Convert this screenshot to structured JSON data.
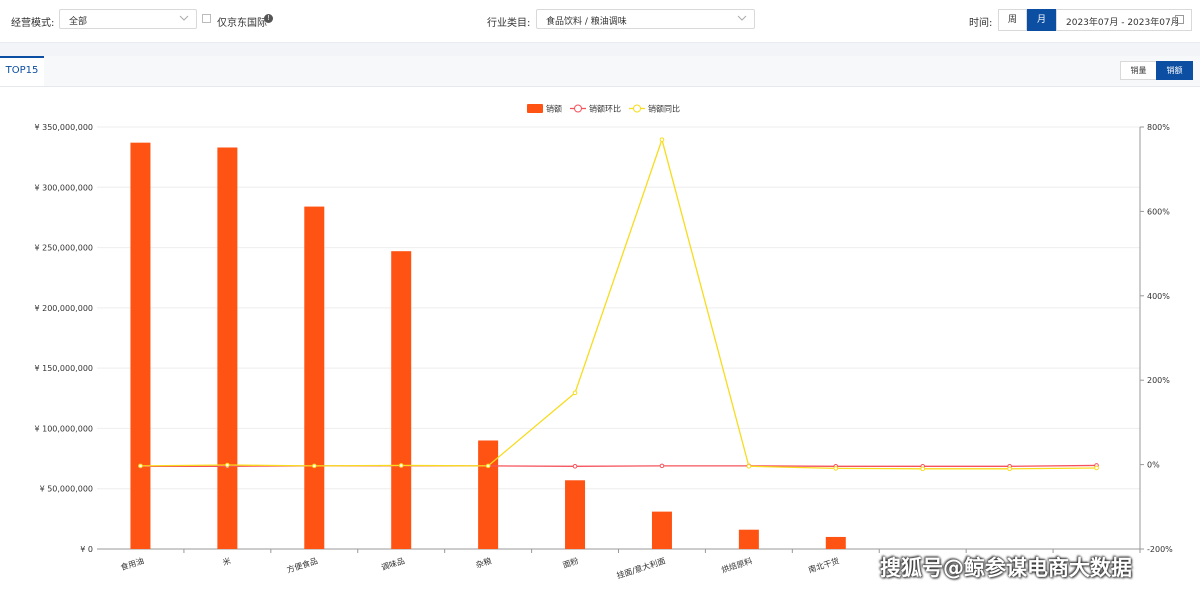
{
  "filters": {
    "mode_label": "经营模式:",
    "mode_value": "全部",
    "jd_intl_label": "仅京东国际",
    "category_label": "行业类目:",
    "category_value": "食品饮料 / 粮油调味",
    "time_label": "时间:",
    "period_week": "周",
    "period_month": "月",
    "date_range": "2023年07月 - 2023年07月"
  },
  "tabs": {
    "top15": "TOP15"
  },
  "metric_toggle": {
    "volume": "销量",
    "amount": "销额"
  },
  "watermark": "搜狐号@鲸参谋电商大数据",
  "colors": {
    "bar": "#ff5314",
    "mom_line": "#f5535c",
    "yoy_line": "#f7dc1d",
    "accent": "#0b4ea2"
  },
  "chart_data": {
    "type": "bar",
    "legend": [
      "销额",
      "销额环比",
      "销额同比"
    ],
    "legend_position": "top-center",
    "categories": [
      "食用油",
      "米",
      "方便食品",
      "调味品",
      "杂粮",
      "面粉",
      "挂面/意大利面",
      "烘焙原料",
      "南北干货",
      "",
      "",
      ""
    ],
    "series": [
      {
        "name": "销额",
        "axis": "left",
        "type": "bar",
        "values": [
          337000000,
          333000000,
          284000000,
          247000000,
          90000000,
          57000000,
          31000000,
          16000000,
          10000000,
          null,
          null,
          null
        ]
      },
      {
        "name": "销额环比",
        "axis": "right",
        "type": "line",
        "values": [
          -4,
          -4,
          -3,
          -3,
          -3,
          -4,
          -3,
          -3,
          -4,
          -4,
          -4,
          -2
        ]
      },
      {
        "name": "销额同比",
        "axis": "right",
        "type": "line",
        "values": [
          -3,
          -1,
          -3,
          -2,
          -3,
          170,
          770,
          -4,
          -9,
          -10,
          -10,
          -8
        ]
      }
    ],
    "y_left": {
      "min": 0,
      "max": 350000000,
      "ticks": [
        "¥ 0",
        "¥ 50,000,000",
        "¥ 100,000,000",
        "¥ 150,000,000",
        "¥ 200,000,000",
        "¥ 250,000,000",
        "¥ 300,000,000",
        "¥ 350,000,000"
      ]
    },
    "y_right": {
      "min": -200,
      "max": 800,
      "ticks": [
        "-200%",
        "0%",
        "200%",
        "400%",
        "600%",
        "800%"
      ]
    },
    "grid": true
  }
}
